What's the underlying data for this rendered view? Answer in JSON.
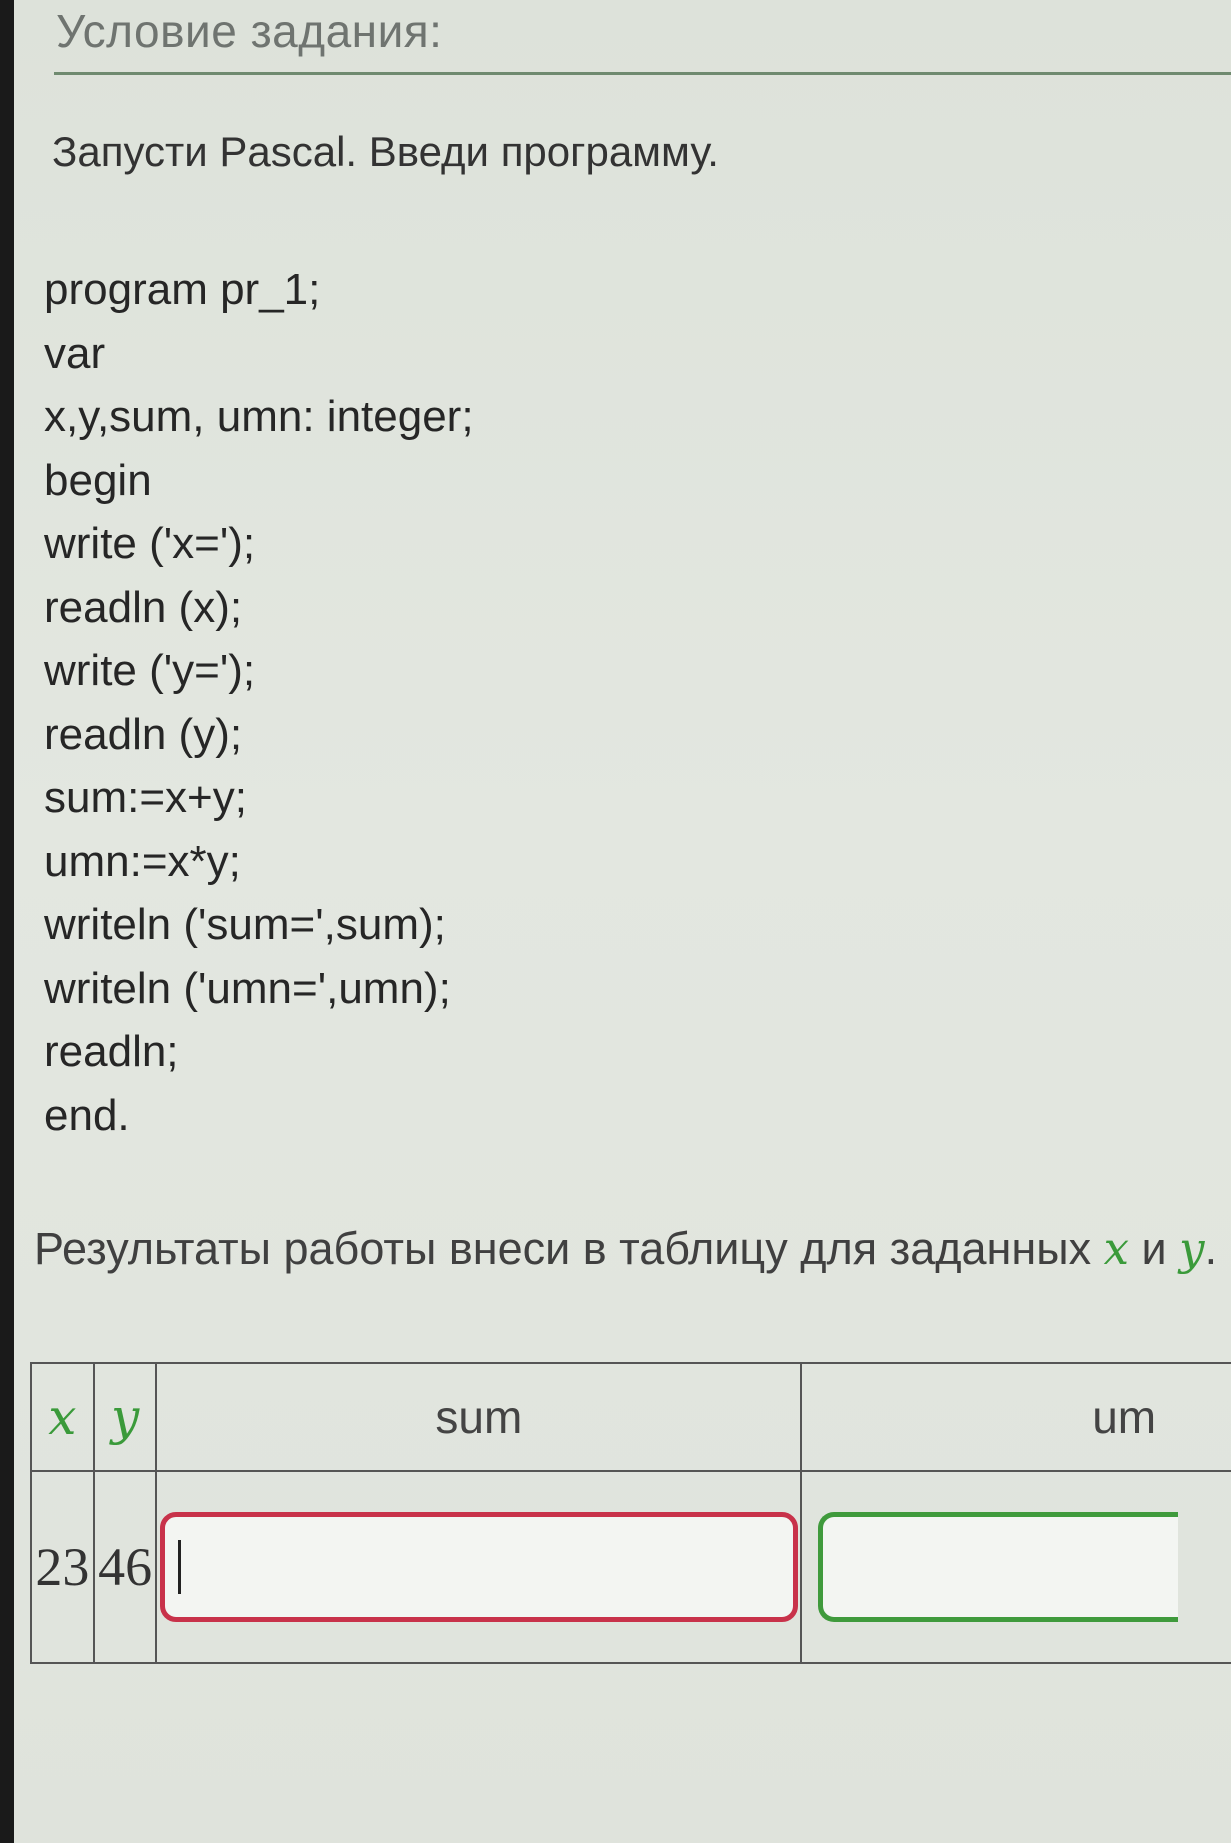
{
  "section": {
    "title": "Условие задания:"
  },
  "intro": "Запусти Pascal. Введи программу.",
  "code_lines": [
    "program pr_1;",
    "var",
    "x,y,sum, umn: integer;",
    "begin",
    "write ('x=');",
    "readln (x);",
    "write ('y=');",
    "readln (y);",
    "sum:=x+y;",
    "umn:=x*y;",
    "writeln ('sum=',sum);",
    "writeln ('umn=',umn);",
    "readln;",
    "end."
  ],
  "result": {
    "text": "Результаты работы внеси в таблицу для заданных",
    "var_x": "x",
    "conj": "и",
    "var_y": "y",
    "period": "."
  },
  "table": {
    "headers": {
      "x": "x",
      "y": "y",
      "sum": "sum",
      "umn": "um"
    },
    "row": {
      "x": "23",
      "y": "46",
      "sum_value": "",
      "umn_value": ""
    }
  },
  "colors": {
    "accent_green": "#3a9a3a",
    "error_red": "#c8324a",
    "ok_green": "#3f9a3c"
  }
}
